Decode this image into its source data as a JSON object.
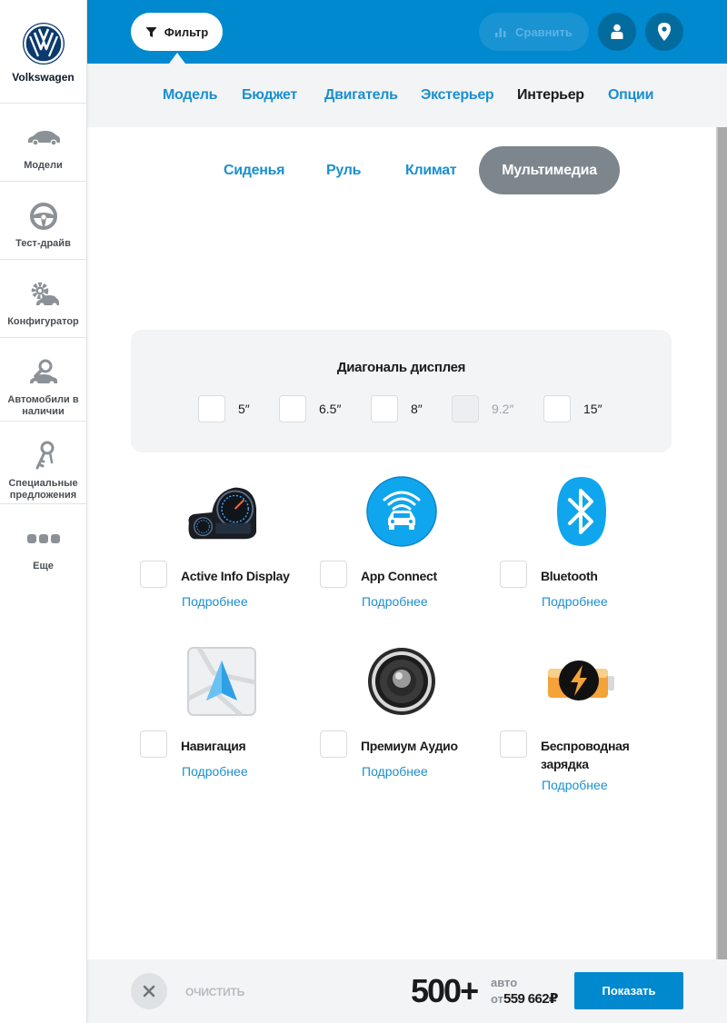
{
  "brand": {
    "name": "Volkswagen",
    "icon": "vw-logo-icon",
    "color": "#0b3a6e"
  },
  "sidebar": {
    "items": [
      {
        "label": "Модели",
        "icon": "car-icon"
      },
      {
        "label": "Тест-драйв",
        "icon": "steering-wheel-icon"
      },
      {
        "label": "Конфигуратор",
        "icon": "gear-car-icon"
      },
      {
        "label": "Автомобили в наличии",
        "icon": "car-search-icon"
      },
      {
        "label": "Специальные предложения",
        "icon": "keys-icon"
      },
      {
        "label": "Еще",
        "icon": "more-dots-icon"
      }
    ]
  },
  "topbar": {
    "filter_label": "Фильтр",
    "compare_label": "Сравнить",
    "accent": "#0089cf"
  },
  "maintabs": [
    "Модель",
    "Бюджет",
    "Двигатель",
    "Экстерьер",
    "Интерьер",
    "Опции"
  ],
  "maintabs_active": "Интерьер",
  "subtabs": [
    "Сиденья",
    "Руль",
    "Климат",
    "Мультимедиа"
  ],
  "subtabs_active": "Мультимедиа",
  "display": {
    "title": "Диагональ дисплея",
    "options": [
      {
        "label": "5″",
        "disabled": false
      },
      {
        "label": "6.5″",
        "disabled": false
      },
      {
        "label": "8″",
        "disabled": false
      },
      {
        "label": "9.2″",
        "disabled": true
      },
      {
        "label": "15″",
        "disabled": false
      }
    ]
  },
  "features": [
    {
      "name": "Active Info Display",
      "more": "Подробнее",
      "icon": "instrument-cluster-icon"
    },
    {
      "name": "App Connect",
      "more": "Подробнее",
      "icon": "car-wifi-icon"
    },
    {
      "name": "Bluetooth",
      "more": "Подробнее",
      "icon": "bluetooth-icon"
    },
    {
      "name": "Навигация",
      "more": "Подробнее",
      "icon": "navigation-arrow-icon"
    },
    {
      "name": "Премиум Аудио",
      "more": "Подробнее",
      "icon": "speaker-icon"
    },
    {
      "name": "Беспроводная зарядка",
      "more": "Подробнее",
      "icon": "battery-charge-icon"
    }
  ],
  "bottombar": {
    "clear_label": "ОЧИСТИТЬ",
    "count": "500+",
    "count_unit": "авто",
    "price_from": "от",
    "price": "559 662₽",
    "show_label": "Показать"
  }
}
